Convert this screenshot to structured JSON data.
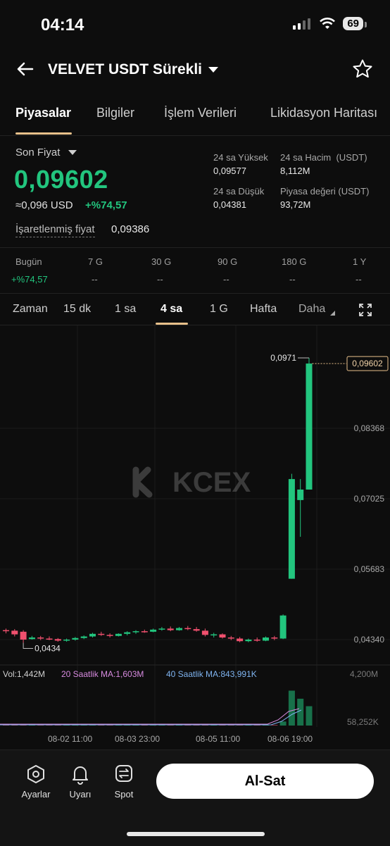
{
  "status": {
    "time": "04:14",
    "battery": "69"
  },
  "header": {
    "title": "VELVET USDT Sürekli"
  },
  "tabs": [
    "Piyasalar",
    "Bilgiler",
    "İşlem Verileri",
    "Likidasyon Haritası"
  ],
  "ticker": {
    "last_label": "Son Fiyat",
    "last_price": "0,09602",
    "usd_value": "≈0,096 USD",
    "change": "+%74,57",
    "mark_label": "İşaretlenmiş fiyat",
    "mark_value": "0,09386"
  },
  "stats": {
    "high_label": "24 sa Yüksek",
    "high_value": "0,09577",
    "low_label": "24 sa Düşük",
    "low_value": "0,04381",
    "vol_label": "24 sa Hacim  (USDT)",
    "vol_value": "8,112M",
    "mcap_label": "Piyasa değeri (USDT)",
    "mcap_value": "93,72M"
  },
  "performance": [
    {
      "label": "Bugün",
      "value": "+%74,57"
    },
    {
      "label": "7 G",
      "value": "--"
    },
    {
      "label": "30 G",
      "value": "--"
    },
    {
      "label": "90 G",
      "value": "--"
    },
    {
      "label": "180 G",
      "value": "--"
    },
    {
      "label": "1 Y",
      "value": "--"
    }
  ],
  "timeframes": [
    "Zaman",
    "15 dk",
    "1 sa",
    "4 sa",
    "1 G",
    "Hafta",
    "Daha"
  ],
  "indicators": {
    "vol": "Vol:1,442M",
    "ma20": "20 Saatlik MA:1,603M",
    "ma40": "40 Saatlik MA:843,991K",
    "vol_max": "4,200M",
    "vol_min": "58,252K"
  },
  "colors": {
    "up": "#22c57e",
    "down": "#f0506e",
    "accent": "#e7c08a",
    "ma20": "#d88be0",
    "ma40": "#7fb4f0"
  },
  "watermark": "KCEX",
  "chart_data": {
    "type": "candlestick",
    "y_ticks": [
      "0,08368",
      "0,07025",
      "0,05683",
      "0,04340"
    ],
    "y_tick_values": [
      0.08368,
      0.07025,
      0.05683,
      0.0434
    ],
    "x_ticks": [
      "08-02 11:00",
      "08-03 23:00",
      "08-05 11:00",
      "08-06 19:00"
    ],
    "last_price_label": "0,09602",
    "last_price": 0.09602,
    "high_label": "0,0971",
    "high": 0.0971,
    "low_label": "0,0434",
    "low": 0.0434,
    "candles": [
      [
        0.0452,
        0.0455,
        0.0446,
        0.045
      ],
      [
        0.0451,
        0.0454,
        0.044,
        0.0444
      ],
      [
        0.0449,
        0.0452,
        0.0428,
        0.0434
      ],
      [
        0.0435,
        0.0441,
        0.0434,
        0.0438
      ],
      [
        0.0438,
        0.0441,
        0.0433,
        0.0436
      ],
      [
        0.0436,
        0.044,
        0.0433,
        0.0435
      ],
      [
        0.0435,
        0.0437,
        0.043,
        0.0432
      ],
      [
        0.0432,
        0.0436,
        0.043,
        0.0434
      ],
      [
        0.0434,
        0.0439,
        0.0432,
        0.0437
      ],
      [
        0.0437,
        0.0442,
        0.0435,
        0.044
      ],
      [
        0.044,
        0.0447,
        0.0438,
        0.0445
      ],
      [
        0.0445,
        0.0449,
        0.0441,
        0.0443
      ],
      [
        0.0443,
        0.0446,
        0.0438,
        0.0441
      ],
      [
        0.0441,
        0.0446,
        0.044,
        0.0445
      ],
      [
        0.0445,
        0.045,
        0.0442,
        0.0448
      ],
      [
        0.0448,
        0.0452,
        0.0445,
        0.045
      ],
      [
        0.045,
        0.0453,
        0.0447,
        0.0449
      ],
      [
        0.0449,
        0.0455,
        0.0448,
        0.0453
      ],
      [
        0.0453,
        0.0458,
        0.0451,
        0.0455
      ],
      [
        0.0455,
        0.0459,
        0.045,
        0.0452
      ],
      [
        0.0452,
        0.0458,
        0.0451,
        0.0456
      ],
      [
        0.0456,
        0.046,
        0.0452,
        0.0454
      ],
      [
        0.0454,
        0.0458,
        0.0449,
        0.0451
      ],
      [
        0.0451,
        0.0455,
        0.044,
        0.0443
      ],
      [
        0.0443,
        0.0447,
        0.0438,
        0.0444
      ],
      [
        0.0444,
        0.0446,
        0.0436,
        0.0438
      ],
      [
        0.0438,
        0.0441,
        0.0433,
        0.0436
      ],
      [
        0.0436,
        0.0439,
        0.0429,
        0.0431
      ],
      [
        0.0431,
        0.0436,
        0.0429,
        0.0434
      ],
      [
        0.0434,
        0.0438,
        0.043,
        0.0432
      ],
      [
        0.0432,
        0.044,
        0.0431,
        0.0438
      ],
      [
        0.0438,
        0.0441,
        0.0433,
        0.0436
      ],
      [
        0.0436,
        0.0482,
        0.0435,
        0.048
      ],
      [
        0.055,
        0.075,
        0.055,
        0.074
      ],
      [
        0.07,
        0.074,
        0.063,
        0.072
      ],
      [
        0.072,
        0.0971,
        0.072,
        0.09602
      ]
    ],
    "volumes": [
      0.05,
      0.04,
      0.06,
      0.04,
      0.04,
      0.05,
      0.04,
      0.04,
      0.04,
      0.05,
      0.05,
      0.04,
      0.04,
      0.04,
      0.05,
      0.04,
      0.04,
      0.05,
      0.04,
      0.05,
      0.04,
      0.04,
      0.05,
      0.06,
      0.04,
      0.05,
      0.04,
      0.05,
      0.04,
      0.04,
      0.05,
      0.04,
      0.3,
      2.6,
      2.0,
      1.442
    ]
  }
}
